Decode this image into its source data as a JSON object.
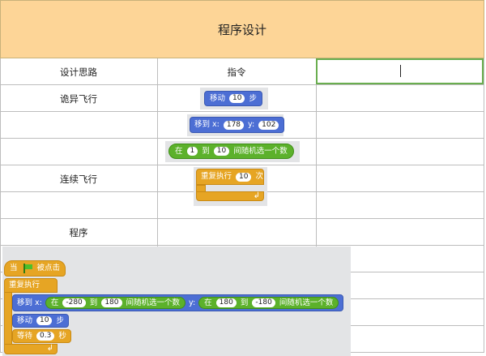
{
  "title": "程序设计",
  "table": {
    "headers": [
      "设计思路",
      "指令"
    ],
    "rows": {
      "r1": "诡异飞行",
      "r2": "连续飞行",
      "r3": "程序"
    }
  },
  "blocks": {
    "move": {
      "label": "移动",
      "steps": "10",
      "unit": "步"
    },
    "goto": {
      "label": "移到 x:",
      "x": "178",
      "ylabel": "y:",
      "y": "102"
    },
    "random": {
      "prefix": "在",
      "from": "1",
      "to_label": "到",
      "to": "10",
      "suffix": "间随机选一个数"
    },
    "repeat": {
      "label": "重复执行",
      "count": "10",
      "unit": "次"
    }
  },
  "program": {
    "hat_prefix": "当",
    "hat_suffix": "被点击",
    "forever": "重复执行",
    "goto_label": "移到 x:",
    "rand1": {
      "prefix": "在",
      "from": "-280",
      "to_label": "到",
      "to": "180",
      "suffix": "间随机选一个数"
    },
    "ylabel": "y:",
    "rand2": {
      "prefix": "在",
      "from": "180",
      "to_label": "到",
      "to": "-180",
      "suffix": "间随机选一个数"
    },
    "move_label": "移动",
    "move_steps": "10",
    "move_unit": "步",
    "wait_label": "等待",
    "wait_value": "0.3",
    "wait_unit": "秒"
  },
  "colors": {
    "header_bg": "#fdd597",
    "motion": "#4c6ed4",
    "operator": "#5cb12b",
    "control": "#e6a524",
    "selection": "#6aae4f"
  }
}
